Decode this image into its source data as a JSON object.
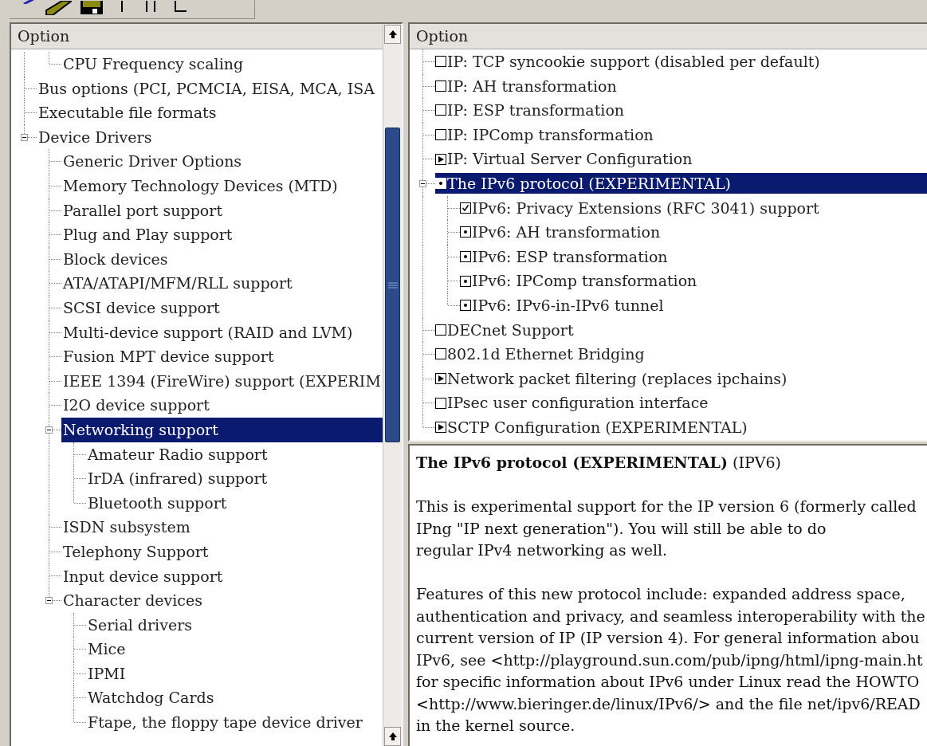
{
  "menu_tree": {
    "header": "Option",
    "items": [
      {
        "children": [
          {
            "label": "CPU Frequency scaling",
            "selected": false
          }
        ]
      },
      {
        "label": "Bus options (PCI, PCMCIA, EISA, MCA, ISA",
        "selected": false
      },
      {
        "label": "Executable file formats",
        "selected": false
      },
      {
        "label": "Device Drivers",
        "selected": false,
        "expanded": true,
        "children": [
          {
            "label": "Generic Driver Options",
            "selected": false
          },
          {
            "label": "Memory Technology Devices (MTD)",
            "selected": false
          },
          {
            "label": "Parallel port support",
            "selected": false
          },
          {
            "label": "Plug and Play support",
            "selected": false
          },
          {
            "label": "Block devices",
            "selected": false
          },
          {
            "label": "ATA/ATAPI/MFM/RLL support",
            "selected": false
          },
          {
            "label": "SCSI device support",
            "selected": false
          },
          {
            "label": "Multi-device support (RAID and LVM)",
            "selected": false
          },
          {
            "label": "Fusion MPT device support",
            "selected": false
          },
          {
            "label": "IEEE 1394 (FireWire) support (EXPERIM",
            "selected": false
          },
          {
            "label": "I2O device support",
            "selected": false
          },
          {
            "label": "Networking support",
            "selected": true,
            "expanded": true,
            "children": [
              {
                "label": "Amateur Radio support",
                "selected": false
              },
              {
                "label": "IrDA (infrared) support",
                "selected": false
              },
              {
                "label": "Bluetooth support",
                "selected": false
              }
            ]
          },
          {
            "label": "ISDN subsystem",
            "selected": false
          },
          {
            "label": "Telephony Support",
            "selected": false
          },
          {
            "label": "Input device support",
            "selected": false
          },
          {
            "label": "Character devices",
            "selected": false,
            "expanded": true,
            "children": [
              {
                "label": "Serial drivers",
                "selected": false
              },
              {
                "label": "Mice",
                "selected": false
              },
              {
                "label": "IPMI",
                "selected": false
              },
              {
                "label": "Watchdog Cards",
                "selected": false
              },
              {
                "label": "Ftape, the floppy tape device driver",
                "selected": false
              }
            ]
          }
        ]
      }
    ]
  },
  "config_tree": {
    "header": "Option",
    "items": [
      {
        "label": "IP: TCP syncookie support (disabled per default)",
        "kind": "bool",
        "checked": false,
        "selected": false
      },
      {
        "label": "IP: AH transformation",
        "kind": "bool",
        "checked": false,
        "selected": false
      },
      {
        "label": "IP: ESP transformation",
        "kind": "bool",
        "checked": false,
        "selected": false
      },
      {
        "label": "IP: IPComp transformation",
        "kind": "bool",
        "checked": false,
        "selected": false
      },
      {
        "label": "IP: Virtual Server Configuration",
        "kind": "menu",
        "selected": false
      },
      {
        "label": "The IPv6 protocol (EXPERIMENTAL)",
        "kind": "module",
        "selected": true,
        "expanded": true,
        "children": [
          {
            "label": "IPv6: Privacy Extensions (RFC 3041) support",
            "kind": "bool",
            "checked": true,
            "selected": false
          },
          {
            "label": "IPv6: AH transformation",
            "kind": "module",
            "selected": false
          },
          {
            "label": "IPv6: ESP transformation",
            "kind": "module",
            "selected": false
          },
          {
            "label": "IPv6: IPComp transformation",
            "kind": "module",
            "selected": false
          },
          {
            "label": "IPv6: IPv6-in-IPv6 tunnel",
            "kind": "module",
            "selected": false
          }
        ]
      },
      {
        "label": "DECnet Support",
        "kind": "bool",
        "checked": false,
        "selected": false
      },
      {
        "label": "802.1d Ethernet Bridging",
        "kind": "bool",
        "checked": false,
        "selected": false
      },
      {
        "label": "Network packet filtering (replaces ipchains)",
        "kind": "menu",
        "selected": false
      },
      {
        "label": "IPsec user configuration interface",
        "kind": "bool",
        "checked": false,
        "selected": false
      },
      {
        "label": "SCTP Configuration (EXPERIMENTAL)",
        "kind": "menu",
        "selected": false
      }
    ]
  },
  "help": {
    "title": "**The IPv6 protocol (EXPERIMENTAL)** (IPV6)",
    "paragraphs": [
      [
        "This is experimental support for the IP version 6 (formerly called",
        "IPng \"IP next generation\"). You will still be able to do",
        "regular IPv4 networking as well."
      ],
      [
        "Features of this new protocol include: expanded address space,",
        "authentication and privacy, and seamless interoperability with the",
        "current version of IP (IP version 4). For general information abou",
        "IPv6, see <http://playground.sun.com/pub/ipng/html/ipng-main.ht",
        "for specific information about IPv6 under Linux read the HOWTO",
        "<http://www.bieringer.de/linux/IPv6/> and the file net/ipv6/READ",
        "in the kernel source."
      ]
    ]
  }
}
